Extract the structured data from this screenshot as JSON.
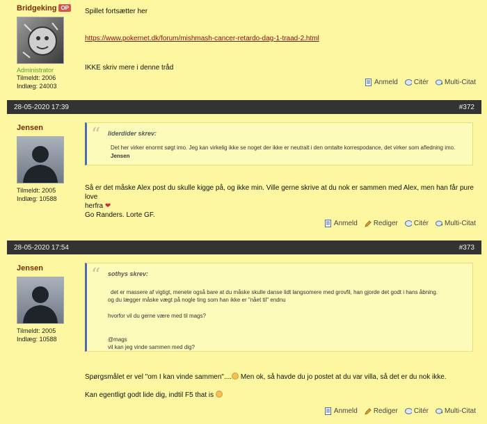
{
  "posts": [
    {
      "user": "Bridgeking",
      "op_badge": "OP",
      "role": "Administrator",
      "joined": "Tilmeldt: 2006",
      "posts": "Indlæg: 24003",
      "lines": [
        "Spillet fortsætter her"
      ],
      "link": "https://www.pokernet.dk/forum/mishmash-cancer-retardo-dag-1-traad-2.html",
      "after": "IKKE skriv mere i denne tråd",
      "actions": [
        "Anmeld",
        "Citér",
        "Multi-Citat"
      ]
    },
    {
      "date": "28-05-2020 17:39",
      "number": "#372",
      "user": "Jensen",
      "joined": "Tilmeldt: 2005",
      "posts": "Indlæg: 10588",
      "quote_author": "liderdider skrev:",
      "quote_text": "Det her virker enormt søgt imo. Jeg kan virkelig ikke se noget der ikke er neutralt i den omtalte korrespodance, det virker som afledning imo.",
      "quote_sig": "Jensen",
      "body1": "Så er det måske Alex post du skulle kigge på, og ikke min. Ville gerne skrive at du nok er sammen med Alex, men han får pure love",
      "body2": "herfra",
      "body3": "Go Randers. Lorte GF.",
      "actions": [
        "Anmeld",
        "Rediger",
        "Citér",
        "Multi-Citat"
      ]
    },
    {
      "date": "28-05-2020 17:54",
      "number": "#373",
      "user": "Jensen",
      "joined": "Tilmeldt: 2005",
      "posts": "Indlæg: 10588",
      "quote_author": "sothys skrev:",
      "quote_line1": "det er massere af vigtigt, menete også bare at du måske skulle danse lidt langsomere med grovfil, han gjorde det godt i  hans åbning.",
      "quote_line2": "og du lægger måske vægt på nogle ting som han ikke er \"nået til\" endnu",
      "quote_line3": "hvorfor vil du gerne være med til mags?",
      "quote_line4": "@mags",
      "quote_line5": "vil kan jeg vinde sammen med dig?",
      "body1a": "Spørgsmålet er vel \"om I kan vinde sammen\"....",
      "body1b": " Men ok, så havde du jo postet at du var villa, så det er du nok ikke.",
      "body2": "Kan egentligt godt lide dig, indtil F5 that is",
      "actions": [
        "Anmeld",
        "Rediger",
        "Citér",
        "Multi-Citat"
      ]
    }
  ]
}
